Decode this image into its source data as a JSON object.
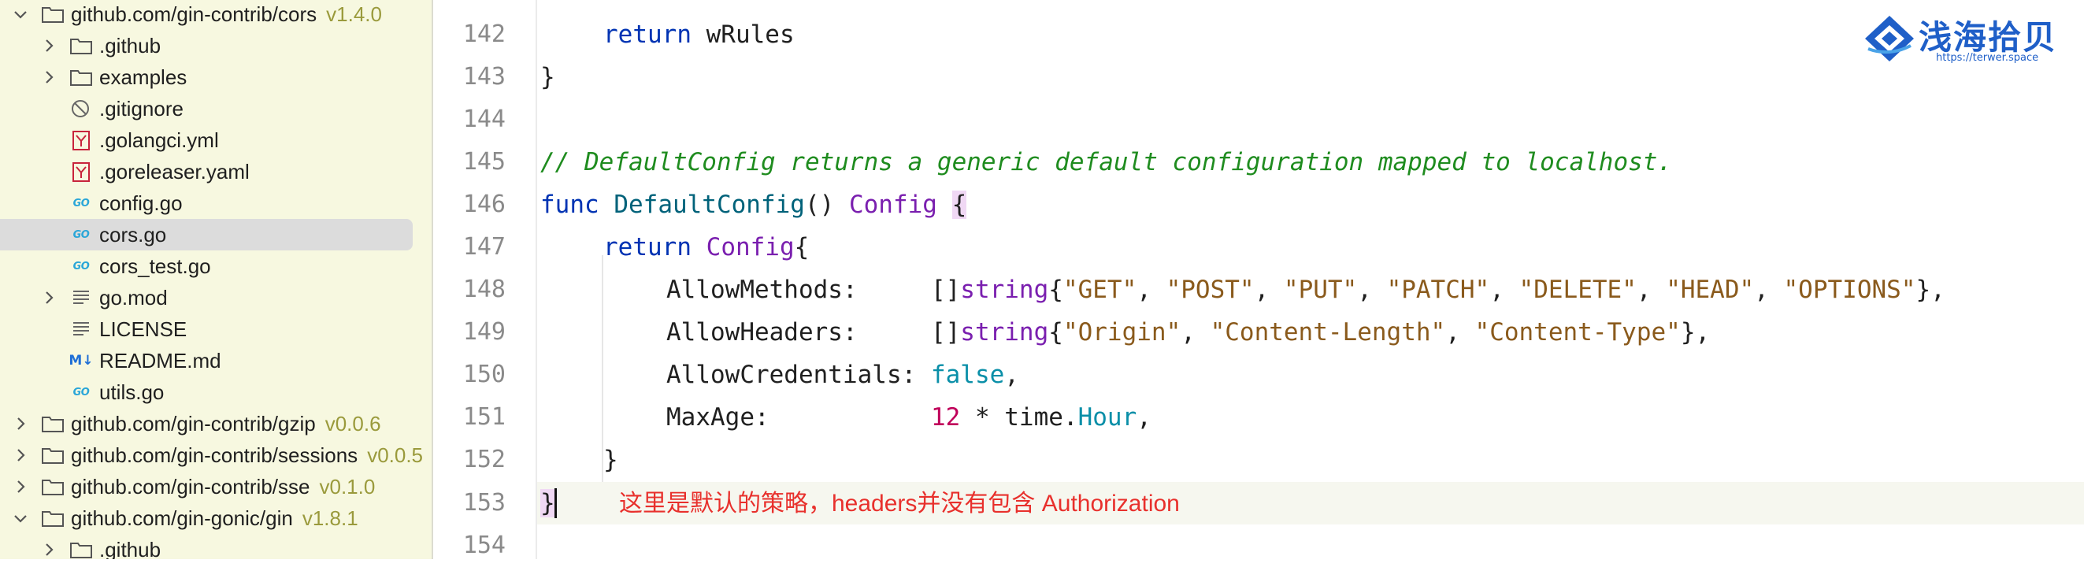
{
  "sidebar": {
    "items": [
      {
        "label": "github.com/gin-contrib/cors",
        "version": "v1.4.0",
        "icon": "folder-icon",
        "chevron": "expanded"
      },
      {
        "label": ".github",
        "icon": "folder-icon",
        "chevron": "collapsed"
      },
      {
        "label": "examples",
        "icon": "folder-icon",
        "chevron": "collapsed"
      },
      {
        "label": ".gitignore",
        "icon": "gitignore-file-icon"
      },
      {
        "label": ".golangci.yml",
        "icon": "yaml-file-icon"
      },
      {
        "label": ".goreleaser.yaml",
        "icon": "yaml-file-icon"
      },
      {
        "label": "config.go",
        "icon": "go-file-icon",
        "badge": "GO"
      },
      {
        "label": "cors.go",
        "icon": "go-file-icon",
        "badge": "GO",
        "selected": true
      },
      {
        "label": "cors_test.go",
        "icon": "go-file-icon",
        "badge": "GO"
      },
      {
        "label": "go.mod",
        "icon": "text-file-icon",
        "chevron": "collapsed"
      },
      {
        "label": "LICENSE",
        "icon": "text-file-icon"
      },
      {
        "label": "README.md",
        "icon": "markdown-file-icon",
        "badge": "M↓"
      },
      {
        "label": "utils.go",
        "icon": "go-file-icon",
        "badge": "GO"
      },
      {
        "label": "github.com/gin-contrib/gzip",
        "version": "v0.0.6",
        "icon": "folder-icon",
        "chevron": "collapsed"
      },
      {
        "label": "github.com/gin-contrib/sessions",
        "version": "v0.0.5",
        "icon": "folder-icon",
        "chevron": "collapsed"
      },
      {
        "label": "github.com/gin-contrib/sse",
        "version": "v0.1.0",
        "icon": "folder-icon",
        "chevron": "collapsed"
      },
      {
        "label": "github.com/gin-gonic/gin",
        "version": "v1.8.1",
        "icon": "folder-icon",
        "chevron": "expanded"
      },
      {
        "label": ".github",
        "icon": "folder-icon",
        "chevron": "collapsed"
      }
    ]
  },
  "editor": {
    "line_numbers": [
      "142",
      "143",
      "144",
      "145",
      "146",
      "147",
      "148",
      "149",
      "150",
      "151",
      "152",
      "153",
      "154"
    ],
    "tokens": {
      "return": "return",
      "wRules": " wRules",
      "close_brace": "}",
      "comment": "// DefaultConfig returns a generic default configuration mapped to localhost.",
      "func": "func",
      "DefaultConfig": "DefaultConfig",
      "parens": "()",
      "Config": "Config",
      "open_brace": "{",
      "AllowMethods": "AllowMethods:     []",
      "string": "string",
      "comma_sp": ", ",
      "comma": ",",
      "methods": [
        "\"GET\"",
        "\"POST\"",
        "\"PUT\"",
        "\"PATCH\"",
        "\"DELETE\"",
        "\"HEAD\"",
        "\"OPTIONS\""
      ],
      "AllowHeaders": "AllowHeaders:     []",
      "headers": [
        "\"Origin\"",
        "\"Content-Length\"",
        "\"Content-Type\""
      ],
      "AllowCredentials": "AllowCredentials: ",
      "false": "false",
      "MaxAge": "MaxAge:           ",
      "twelve": "12",
      "times_time": " * time.",
      "Hour": "Hour",
      "brace_comma": "},"
    },
    "annotation": "这里是默认的策略，headers并没有包含 Authorization"
  },
  "watermark": {
    "brand": "浅海拾贝",
    "url": "https://terwer.space"
  },
  "colors": {
    "sidebar_bg": "#f7f8e0",
    "keyword": "#0033b3",
    "function": "#00627a",
    "type": "#7a1faf",
    "string": "#8a5a1c",
    "number": "#c0005a",
    "comment": "#1f8c1f",
    "annotation": "#e8302c",
    "brand": "#1f5fc8"
  }
}
